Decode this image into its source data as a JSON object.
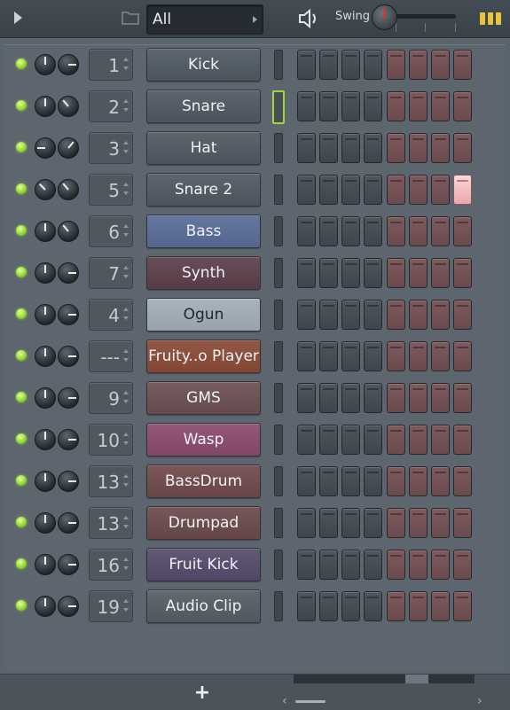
{
  "toolbar": {
    "filter_value": "All",
    "swing_label": "Swing",
    "icons": [
      "play-arrow-icon",
      "folder-icon",
      "chevron-right-icon",
      "speaker-icon",
      "pattern-icon"
    ]
  },
  "channels": [
    {
      "number": "1",
      "name": "Kick",
      "color": "#4f5961",
      "vol_rot": 0,
      "pan_rot": 90,
      "steps_on": []
    },
    {
      "number": "2",
      "name": "Snare",
      "color": "#4f5961",
      "vol_rot": 0,
      "pan_rot": -40,
      "steps_on": [],
      "selected": true
    },
    {
      "number": "3",
      "name": "Hat",
      "color": "#4f5961",
      "vol_rot": -90,
      "pan_rot": 40,
      "steps_on": []
    },
    {
      "number": "5",
      "name": "Snare 2",
      "color": "#4f5961",
      "vol_rot": -45,
      "pan_rot": -40,
      "steps_on": [
        7
      ]
    },
    {
      "number": "6",
      "name": "Bass",
      "color": "#596b98",
      "vol_rot": 0,
      "pan_rot": -40,
      "steps_on": []
    },
    {
      "number": "7",
      "name": "Synth",
      "color": "#5c3e4a",
      "vol_rot": 0,
      "pan_rot": 90,
      "steps_on": []
    },
    {
      "number": "4",
      "name": "Ogun",
      "color": "#a2adb6",
      "vol_rot": 0,
      "pan_rot": 90,
      "steps_on": []
    },
    {
      "number": "---",
      "name": "Fruity..o Player",
      "color": "#8a4a36",
      "vol_rot": 0,
      "pan_rot": 90,
      "steps_on": []
    },
    {
      "number": "9",
      "name": "GMS",
      "color": "#6b4e52",
      "vol_rot": 0,
      "pan_rot": 90,
      "steps_on": []
    },
    {
      "number": "10",
      "name": "Wasp",
      "color": "#8a4a6d",
      "vol_rot": 0,
      "pan_rot": 90,
      "steps_on": []
    },
    {
      "number": "13",
      "name": "BassDrum",
      "color": "#70494c",
      "vol_rot": 0,
      "pan_rot": 90,
      "steps_on": []
    },
    {
      "number": "13",
      "name": "Drumpad",
      "color": "#6b4a4c",
      "vol_rot": 0,
      "pan_rot": 90,
      "steps_on": []
    },
    {
      "number": "16",
      "name": "Fruit Kick",
      "color": "#564a6b",
      "vol_rot": 0,
      "pan_rot": 90,
      "steps_on": []
    },
    {
      "number": "19",
      "name": "Audio Clip",
      "color": "#545d65",
      "vol_rot": 0,
      "pan_rot": 90,
      "steps_on": []
    }
  ],
  "bottom": {
    "add_label": "+",
    "scroll_left": "‹",
    "scroll_right": "›"
  }
}
